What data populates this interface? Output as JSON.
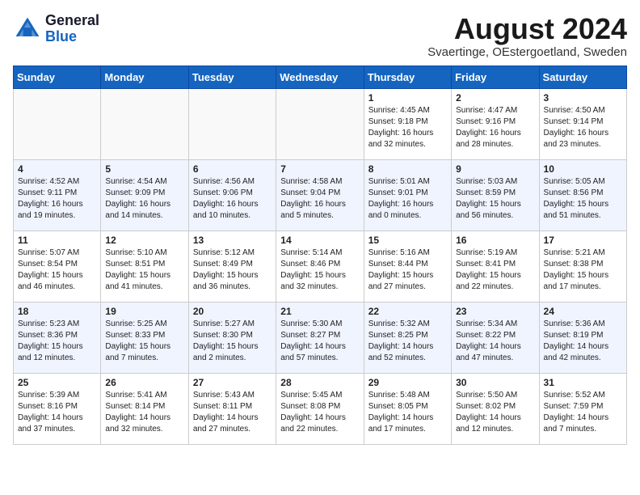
{
  "header": {
    "logo_general": "General",
    "logo_blue": "Blue",
    "main_title": "August 2024",
    "subtitle": "Svaertinge, OEstergoetland, Sweden"
  },
  "weekdays": [
    "Sunday",
    "Monday",
    "Tuesday",
    "Wednesday",
    "Thursday",
    "Friday",
    "Saturday"
  ],
  "weeks": [
    [
      {
        "day": "",
        "info": ""
      },
      {
        "day": "",
        "info": ""
      },
      {
        "day": "",
        "info": ""
      },
      {
        "day": "",
        "info": ""
      },
      {
        "day": "1",
        "info": "Sunrise: 4:45 AM\nSunset: 9:18 PM\nDaylight: 16 hours\nand 32 minutes."
      },
      {
        "day": "2",
        "info": "Sunrise: 4:47 AM\nSunset: 9:16 PM\nDaylight: 16 hours\nand 28 minutes."
      },
      {
        "day": "3",
        "info": "Sunrise: 4:50 AM\nSunset: 9:14 PM\nDaylight: 16 hours\nand 23 minutes."
      }
    ],
    [
      {
        "day": "4",
        "info": "Sunrise: 4:52 AM\nSunset: 9:11 PM\nDaylight: 16 hours\nand 19 minutes."
      },
      {
        "day": "5",
        "info": "Sunrise: 4:54 AM\nSunset: 9:09 PM\nDaylight: 16 hours\nand 14 minutes."
      },
      {
        "day": "6",
        "info": "Sunrise: 4:56 AM\nSunset: 9:06 PM\nDaylight: 16 hours\nand 10 minutes."
      },
      {
        "day": "7",
        "info": "Sunrise: 4:58 AM\nSunset: 9:04 PM\nDaylight: 16 hours\nand 5 minutes."
      },
      {
        "day": "8",
        "info": "Sunrise: 5:01 AM\nSunset: 9:01 PM\nDaylight: 16 hours\nand 0 minutes."
      },
      {
        "day": "9",
        "info": "Sunrise: 5:03 AM\nSunset: 8:59 PM\nDaylight: 15 hours\nand 56 minutes."
      },
      {
        "day": "10",
        "info": "Sunrise: 5:05 AM\nSunset: 8:56 PM\nDaylight: 15 hours\nand 51 minutes."
      }
    ],
    [
      {
        "day": "11",
        "info": "Sunrise: 5:07 AM\nSunset: 8:54 PM\nDaylight: 15 hours\nand 46 minutes."
      },
      {
        "day": "12",
        "info": "Sunrise: 5:10 AM\nSunset: 8:51 PM\nDaylight: 15 hours\nand 41 minutes."
      },
      {
        "day": "13",
        "info": "Sunrise: 5:12 AM\nSunset: 8:49 PM\nDaylight: 15 hours\nand 36 minutes."
      },
      {
        "day": "14",
        "info": "Sunrise: 5:14 AM\nSunset: 8:46 PM\nDaylight: 15 hours\nand 32 minutes."
      },
      {
        "day": "15",
        "info": "Sunrise: 5:16 AM\nSunset: 8:44 PM\nDaylight: 15 hours\nand 27 minutes."
      },
      {
        "day": "16",
        "info": "Sunrise: 5:19 AM\nSunset: 8:41 PM\nDaylight: 15 hours\nand 22 minutes."
      },
      {
        "day": "17",
        "info": "Sunrise: 5:21 AM\nSunset: 8:38 PM\nDaylight: 15 hours\nand 17 minutes."
      }
    ],
    [
      {
        "day": "18",
        "info": "Sunrise: 5:23 AM\nSunset: 8:36 PM\nDaylight: 15 hours\nand 12 minutes."
      },
      {
        "day": "19",
        "info": "Sunrise: 5:25 AM\nSunset: 8:33 PM\nDaylight: 15 hours\nand 7 minutes."
      },
      {
        "day": "20",
        "info": "Sunrise: 5:27 AM\nSunset: 8:30 PM\nDaylight: 15 hours\nand 2 minutes."
      },
      {
        "day": "21",
        "info": "Sunrise: 5:30 AM\nSunset: 8:27 PM\nDaylight: 14 hours\nand 57 minutes."
      },
      {
        "day": "22",
        "info": "Sunrise: 5:32 AM\nSunset: 8:25 PM\nDaylight: 14 hours\nand 52 minutes."
      },
      {
        "day": "23",
        "info": "Sunrise: 5:34 AM\nSunset: 8:22 PM\nDaylight: 14 hours\nand 47 minutes."
      },
      {
        "day": "24",
        "info": "Sunrise: 5:36 AM\nSunset: 8:19 PM\nDaylight: 14 hours\nand 42 minutes."
      }
    ],
    [
      {
        "day": "25",
        "info": "Sunrise: 5:39 AM\nSunset: 8:16 PM\nDaylight: 14 hours\nand 37 minutes."
      },
      {
        "day": "26",
        "info": "Sunrise: 5:41 AM\nSunset: 8:14 PM\nDaylight: 14 hours\nand 32 minutes."
      },
      {
        "day": "27",
        "info": "Sunrise: 5:43 AM\nSunset: 8:11 PM\nDaylight: 14 hours\nand 27 minutes."
      },
      {
        "day": "28",
        "info": "Sunrise: 5:45 AM\nSunset: 8:08 PM\nDaylight: 14 hours\nand 22 minutes."
      },
      {
        "day": "29",
        "info": "Sunrise: 5:48 AM\nSunset: 8:05 PM\nDaylight: 14 hours\nand 17 minutes."
      },
      {
        "day": "30",
        "info": "Sunrise: 5:50 AM\nSunset: 8:02 PM\nDaylight: 14 hours\nand 12 minutes."
      },
      {
        "day": "31",
        "info": "Sunrise: 5:52 AM\nSunset: 7:59 PM\nDaylight: 14 hours\nand 7 minutes."
      }
    ]
  ]
}
